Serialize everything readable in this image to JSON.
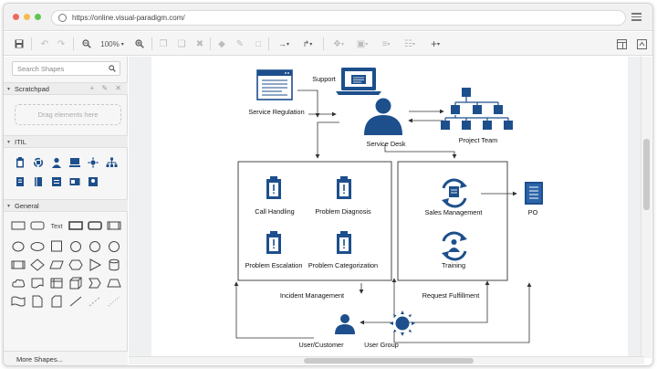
{
  "browser": {
    "url": "https://online.visual-paradigm.com/",
    "dot_colors": [
      "#ee6a5e",
      "#f5bd4f",
      "#61c554"
    ]
  },
  "toolbar": {
    "zoom": "100%"
  },
  "sidebar": {
    "search_placeholder": "Search Shapes",
    "scratchpad_label": "Scratchpad",
    "scratchpad_hint": "Drag elements here",
    "itil_label": "ITIL",
    "general_label": "General",
    "more_shapes": "More Shapes..."
  },
  "diagram": {
    "accent": "#1d4f8c",
    "nodes": {
      "service_regulation": "Service Regulation",
      "support": "Support",
      "service_desk": "Service Desk",
      "project_team": "Project Team",
      "call_handling": "Call Handling",
      "problem_diagnosis": "Problem Diagnosis",
      "problem_escalation": "Problem Escalation",
      "problem_categorization": "Problem Categorization",
      "incident_management": "Incident Management",
      "sales_management": "Sales Management",
      "po": "PO",
      "training": "Training",
      "request_fulfillment": "Request Fulfillment",
      "user_customer": "User/Customer",
      "user_group": "User Group"
    }
  }
}
